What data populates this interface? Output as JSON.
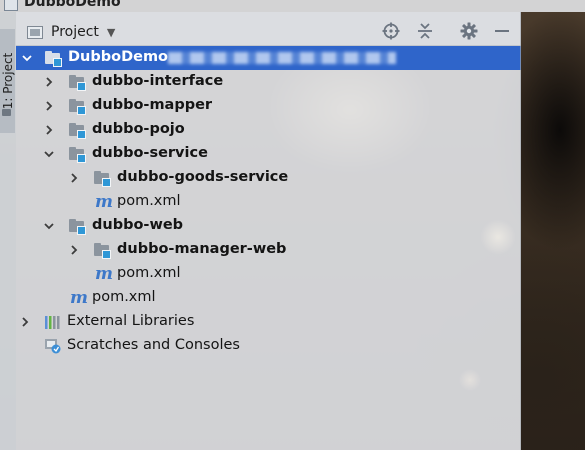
{
  "window": {
    "title": "DubboDemo"
  },
  "side_tab": {
    "label": "1: Project"
  },
  "panel": {
    "view_selector": "Project",
    "toolbar": {
      "locate_icon": "crosshair-icon",
      "collapse_icon": "collapse-all-icon",
      "settings_icon": "gear-icon",
      "hide_icon": "minimize-icon"
    }
  },
  "tree": {
    "root": {
      "label": "DubboDemo",
      "icon": "module-folder-icon",
      "expanded": true
    },
    "items": [
      {
        "label": "dubbo-interface",
        "type": "module",
        "expanded": false
      },
      {
        "label": "dubbo-mapper",
        "type": "module",
        "expanded": false
      },
      {
        "label": "dubbo-pojo",
        "type": "module",
        "expanded": false
      },
      {
        "label": "dubbo-service",
        "type": "module",
        "expanded": true
      },
      {
        "label": "dubbo-goods-service",
        "type": "module",
        "expanded": false
      },
      {
        "label": "pom.xml",
        "type": "maven"
      },
      {
        "label": "dubbo-web",
        "type": "module",
        "expanded": true
      },
      {
        "label": "dubbo-manager-web",
        "type": "module",
        "expanded": false
      },
      {
        "label": "pom.xml",
        "type": "maven"
      },
      {
        "label": "pom.xml",
        "type": "maven"
      },
      {
        "label": "External Libraries",
        "type": "libraries",
        "expanded": false
      },
      {
        "label": "Scratches and Consoles",
        "type": "scratches"
      }
    ]
  },
  "colors": {
    "selection": "#2f65ca",
    "module_accent": "#2f97d6",
    "maven": "#3d78c9"
  }
}
